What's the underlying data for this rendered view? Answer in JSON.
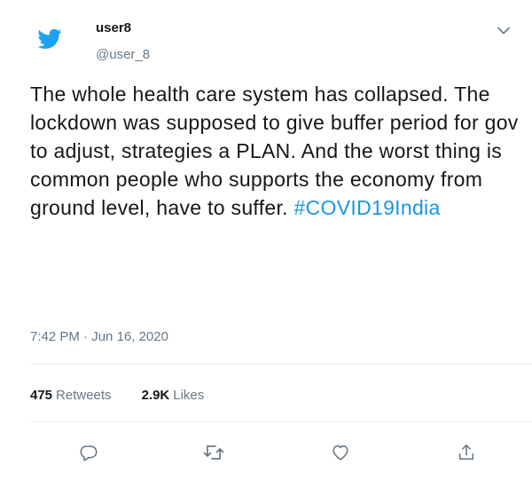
{
  "tweet": {
    "display_name": "user8",
    "handle": "@user_8",
    "text": "The whole health care system has collapsed. The lockdown was supposed to give buffer period for gov to adjust, strategies a PLAN. And the worst thing is common people who supports the economy from ground level, have to suffer. ",
    "hashtag": "#COVID19India",
    "time": "7:42 PM",
    "separator": " · ",
    "date": "Jun 16, 2020",
    "retweets_count": "475",
    "retweets_label": "Retweets",
    "likes_count": "2.9K",
    "likes_label": "Likes"
  },
  "icons": {
    "logo": "twitter-bird-icon",
    "caret": "chevron-down-icon",
    "reply": "reply-icon",
    "retweet": "retweet-icon",
    "like": "heart-icon",
    "share": "share-icon"
  },
  "colors": {
    "brand": "#1da1f2",
    "link": "#1b95e0",
    "text": "#14171a",
    "secondary": "#657786",
    "divider": "#e6ecf0"
  }
}
